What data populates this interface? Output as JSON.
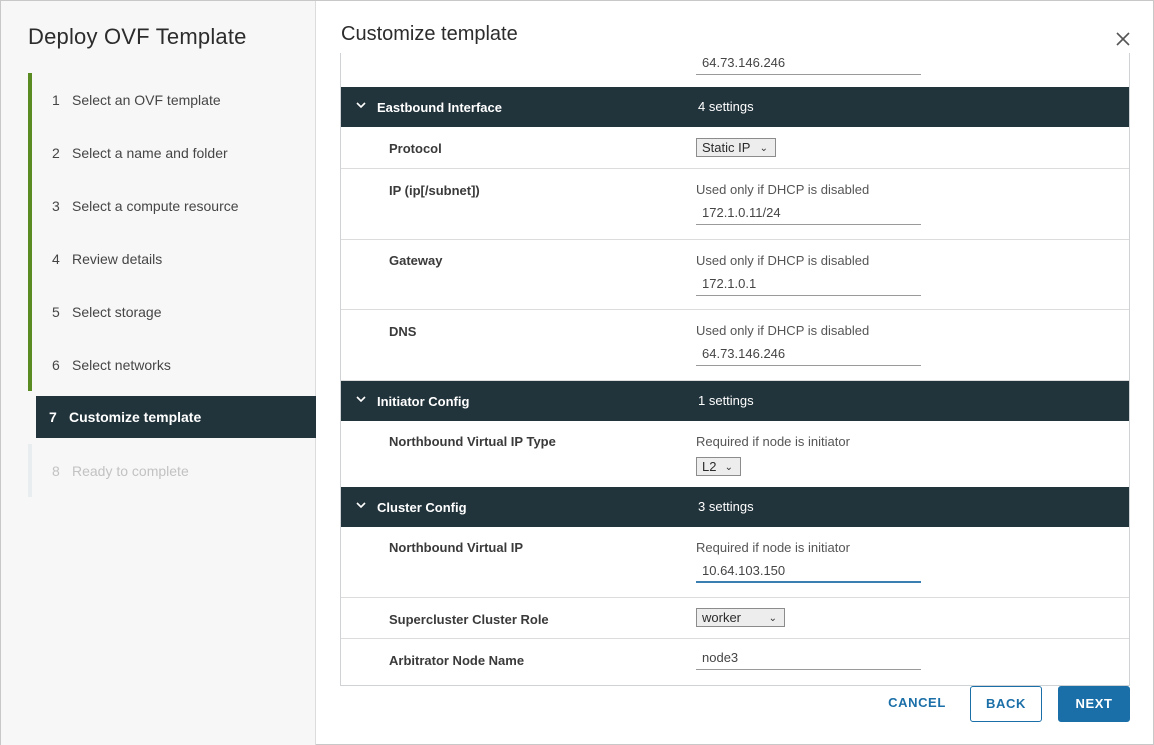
{
  "sidebar": {
    "title": "Deploy OVF Template",
    "steps": [
      {
        "num": "1",
        "label": "Select an OVF template"
      },
      {
        "num": "2",
        "label": "Select a name and folder"
      },
      {
        "num": "3",
        "label": "Select a compute resource"
      },
      {
        "num": "4",
        "label": "Review details"
      },
      {
        "num": "5",
        "label": "Select storage"
      },
      {
        "num": "6",
        "label": "Select networks"
      },
      {
        "num": "7",
        "label": "Customize template"
      },
      {
        "num": "8",
        "label": "Ready to complete"
      }
    ]
  },
  "main": {
    "title": "Customize template",
    "top_field_value": "64.73.146.246",
    "eastbound": {
      "title": "Eastbound Interface",
      "count": "4 settings",
      "protocol_label": "Protocol",
      "protocol_value": "Static IP",
      "ip_label": "IP (ip[/subnet])",
      "ip_hint": "Used only if DHCP is disabled",
      "ip_value": "172.1.0.11/24",
      "gateway_label": "Gateway",
      "gateway_hint": "Used only if DHCP is disabled",
      "gateway_value": "172.1.0.1",
      "dns_label": "DNS",
      "dns_hint": "Used only if DHCP is disabled",
      "dns_value": "64.73.146.246"
    },
    "initiator": {
      "title": "Initiator Config",
      "count": "1 settings",
      "vip_type_label": "Northbound Virtual IP Type",
      "vip_type_hint": "Required if node is initiator",
      "vip_type_value": "L2"
    },
    "cluster": {
      "title": "Cluster Config",
      "count": "3 settings",
      "vip_label": "Northbound Virtual IP",
      "vip_hint": "Required if node is initiator",
      "vip_value": "10.64.103.150",
      "role_label": "Supercluster Cluster Role",
      "role_value": "worker",
      "arb_label": "Arbitrator Node Name",
      "arb_value": "node3"
    }
  },
  "footer": {
    "cancel": "CANCEL",
    "back": "BACK",
    "next": "NEXT"
  },
  "colors": {
    "header_bg": "#21333b",
    "accent": "#1b6fa8",
    "step_done": "#5a8a22"
  },
  "icons": {
    "close": "close-icon",
    "group_toggle": "chevron-down-icon",
    "select_toggle": "chevron-down-icon"
  }
}
